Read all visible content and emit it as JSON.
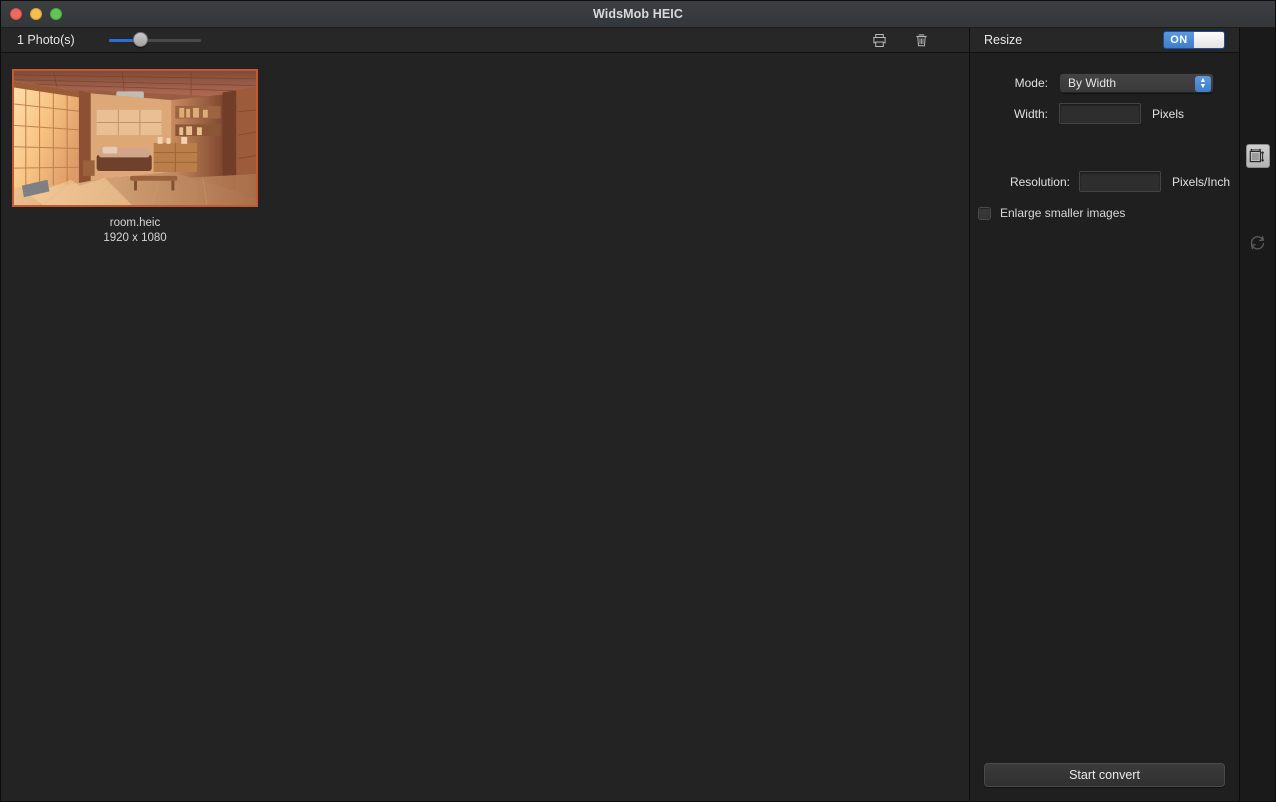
{
  "window": {
    "title": "WidsMob HEIC",
    "traffic_lights": [
      "close",
      "minimize",
      "zoom"
    ]
  },
  "toolbar": {
    "photo_count_label": "1 Photo(s)",
    "zoom_slider": {
      "value": 30,
      "min": 0,
      "max": 100
    },
    "icons": [
      {
        "name": "print-icon",
        "label": "Print"
      },
      {
        "name": "trash-icon",
        "label": "Delete"
      }
    ]
  },
  "gallery": {
    "items": [
      {
        "filename": "room.heic",
        "dimensions": "1920 x 1080",
        "selected": true,
        "selection_color": "#c45a2e"
      }
    ]
  },
  "panel": {
    "title": "Resize",
    "toggle": {
      "state": "ON",
      "on_color": "#4a8ad4"
    },
    "mode": {
      "label": "Mode:",
      "value": "By Width"
    },
    "width": {
      "label": "Width:",
      "value": "",
      "unit": "Pixels"
    },
    "resolution": {
      "label": "Resolution:",
      "value": "",
      "unit": "Pixels/Inch"
    },
    "enlarge": {
      "label": "Enlarge smaller images",
      "checked": false
    },
    "start_button": "Start convert"
  },
  "rail": {
    "buttons": [
      {
        "name": "resize-tool-icon",
        "label": "Resize",
        "active": true
      },
      {
        "name": "rotate-tool-icon",
        "label": "Rotate",
        "active": false
      }
    ]
  }
}
